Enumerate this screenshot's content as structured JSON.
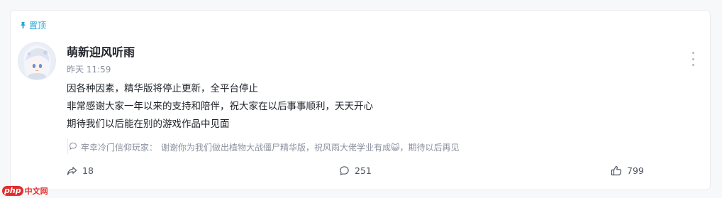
{
  "colors": {
    "pin": "#2aa5d6",
    "text_primary": "#1f2329",
    "text_muted": "#8a919f",
    "watermark": "#e02d2d"
  },
  "post": {
    "pin_label": "置顶",
    "pin_icon": "pin-icon",
    "author": "萌新迎风听雨",
    "time": "昨天 11:59",
    "more_icon": "more-vertical-icon",
    "content": [
      "因各种因素，精华版将停止更新，全平台停止",
      "非常感谢大家一年以来的支持和陪伴，祝大家在以后事事顺利，天天开心",
      "期待我们以后能在别的游戏作品中见面"
    ]
  },
  "top_comment": {
    "icon": "comment-bubble-icon",
    "author": "牢幸冷门信仰玩家：",
    "text": "谢谢你为我们做出植物大战僵尸精华版，祝风雨大佬学业有成",
    "emoji": "😺",
    "text_after": "，期待以后再见"
  },
  "actions": {
    "share": {
      "icon": "share-icon",
      "count": "18"
    },
    "comments": {
      "icon": "comment-icon",
      "count": "251"
    },
    "likes": {
      "icon": "thumbs-up-icon",
      "count": "799"
    }
  },
  "watermark": {
    "logo": "php",
    "text": "中文网"
  }
}
